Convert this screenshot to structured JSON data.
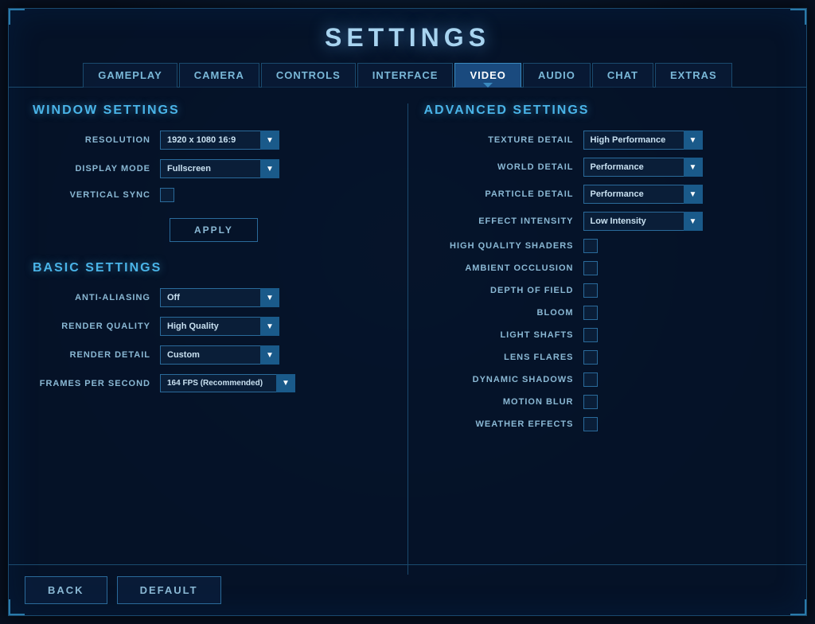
{
  "title": "SETTINGS",
  "tabs": [
    {
      "id": "gameplay",
      "label": "GAMEPLAY",
      "active": false
    },
    {
      "id": "camera",
      "label": "CAMERA",
      "active": false
    },
    {
      "id": "controls",
      "label": "CONTROLS",
      "active": false
    },
    {
      "id": "interface",
      "label": "INTERFACE",
      "active": false
    },
    {
      "id": "video",
      "label": "VIDEO",
      "active": true
    },
    {
      "id": "audio",
      "label": "AUDIO",
      "active": false
    },
    {
      "id": "chat",
      "label": "CHAT",
      "active": false
    },
    {
      "id": "extras",
      "label": "EXTRAS",
      "active": false
    }
  ],
  "window_settings": {
    "title": "WINDOW SETTINGS",
    "resolution_label": "RESOLUTION",
    "resolution_value": "1920 x 1080 16:9",
    "display_mode_label": "DISPLAY MODE",
    "display_mode_value": "Fullscreen",
    "vertical_sync_label": "VERTICAL SYNC",
    "apply_label": "APPLY"
  },
  "basic_settings": {
    "title": "BASIC SETTINGS",
    "anti_aliasing_label": "ANTI-ALIASING",
    "anti_aliasing_value": "Off",
    "render_quality_label": "RENDER QUALITY",
    "render_quality_value": "High Quality",
    "render_detail_label": "RENDER DETAIL",
    "render_detail_value": "Custom",
    "frames_per_second_label": "FRAMES PER SECOND",
    "frames_per_second_value": "164 FPS (Recommended)"
  },
  "advanced_settings": {
    "title": "ADVANCED SETTINGS",
    "texture_detail_label": "TEXTURE DETAIL",
    "texture_detail_value": "High Performance",
    "world_detail_label": "WORLD DETAIL",
    "world_detail_value": "Performance",
    "particle_detail_label": "PARTICLE DETAIL",
    "particle_detail_value": "Performance",
    "effect_intensity_label": "EFFECT INTENSITY",
    "effect_intensity_value": "Low Intensity",
    "high_quality_shaders_label": "HIGH QUALITY SHADERS",
    "ambient_occlusion_label": "AMBIENT OCCLUSION",
    "depth_of_field_label": "DEPTH OF FIELD",
    "bloom_label": "BLOOM",
    "light_shafts_label": "LIGHT SHAFTS",
    "lens_flares_label": "LENS FLARES",
    "dynamic_shadows_label": "DYNAMIC SHADOWS",
    "motion_blur_label": "MOTION BLUR",
    "weather_effects_label": "WEATHER EFFECTS"
  },
  "bottom": {
    "back_label": "BACK",
    "default_label": "DEFAULT"
  }
}
